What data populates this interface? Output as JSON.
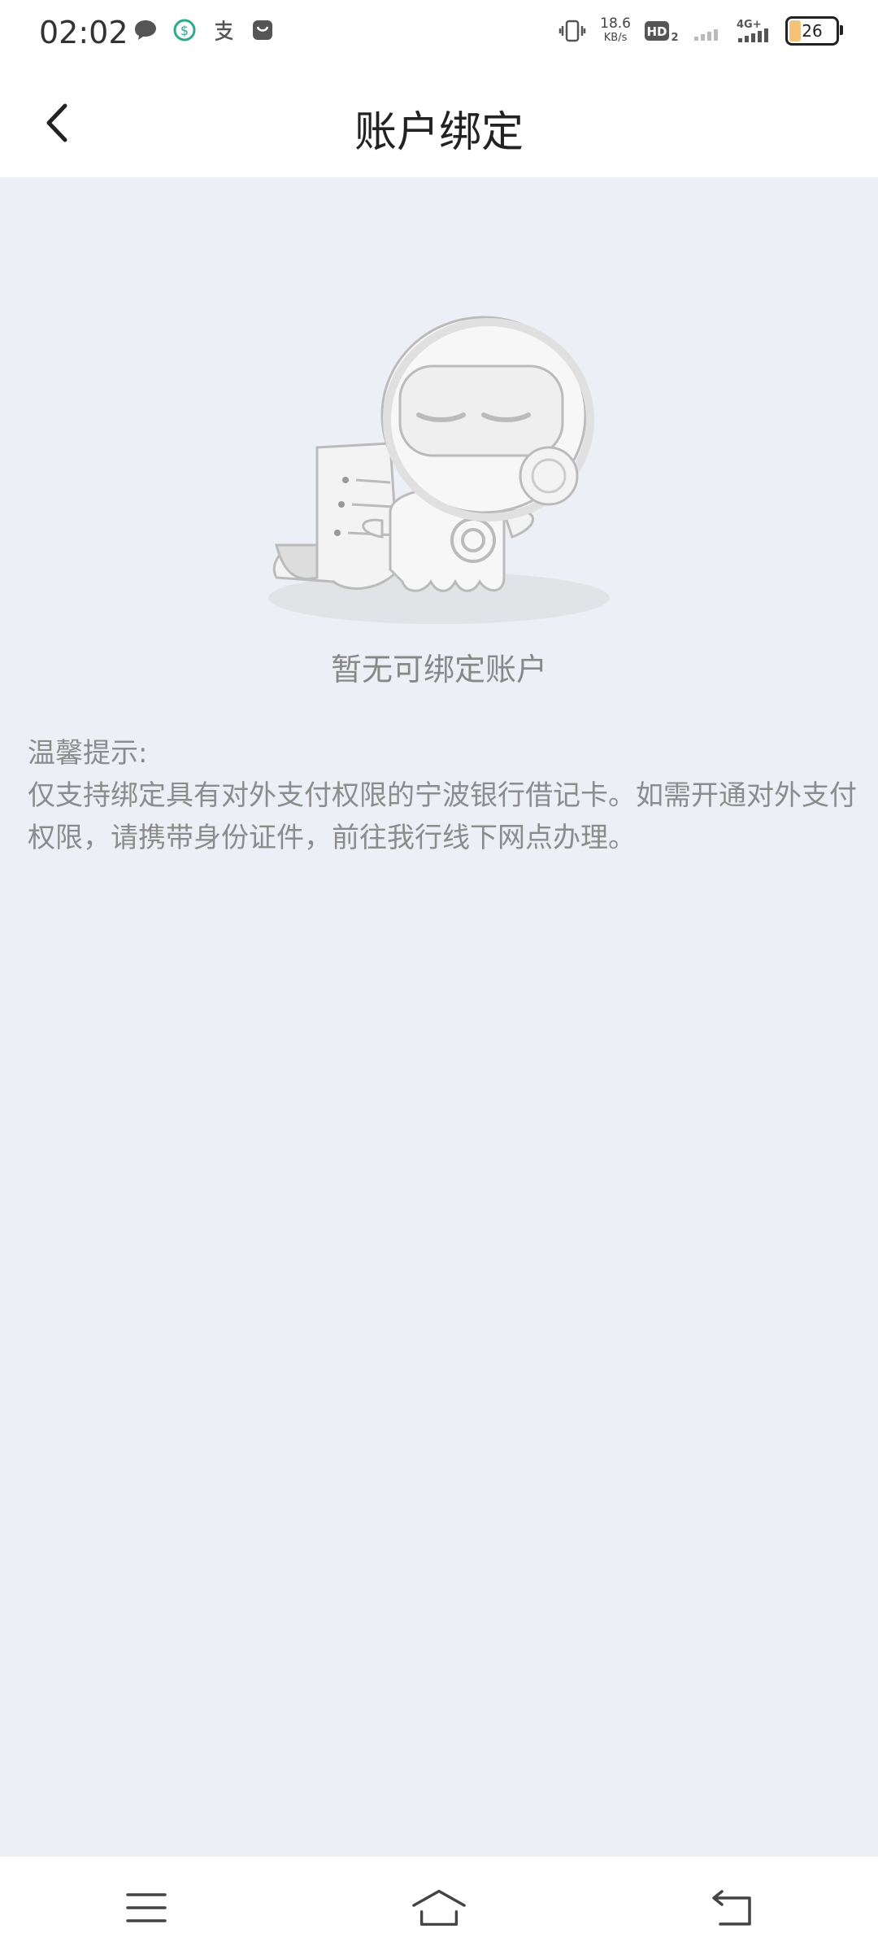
{
  "status_bar": {
    "time": "02:02",
    "net_speed_value": "18.6",
    "net_speed_unit": "KB/s",
    "network": "4G",
    "battery": "26"
  },
  "header": {
    "title": "账户绑定"
  },
  "empty_state": {
    "message": "暂无可绑定账户"
  },
  "tips": {
    "title": "温馨提示:",
    "body": "仅支持绑定具有对外支付权限的宁波银行借记卡。如需开通对外支付权限，请携带身份证件，前往我行线下网点办理。"
  },
  "colors": {
    "background": "#ECEFF6",
    "header_bg": "#FFFFFF",
    "hint_text": "#8C8C8C"
  },
  "icons": {
    "back": "back-arrow-icon",
    "menu": "menu-icon",
    "home": "home-icon",
    "return": "return-icon"
  }
}
